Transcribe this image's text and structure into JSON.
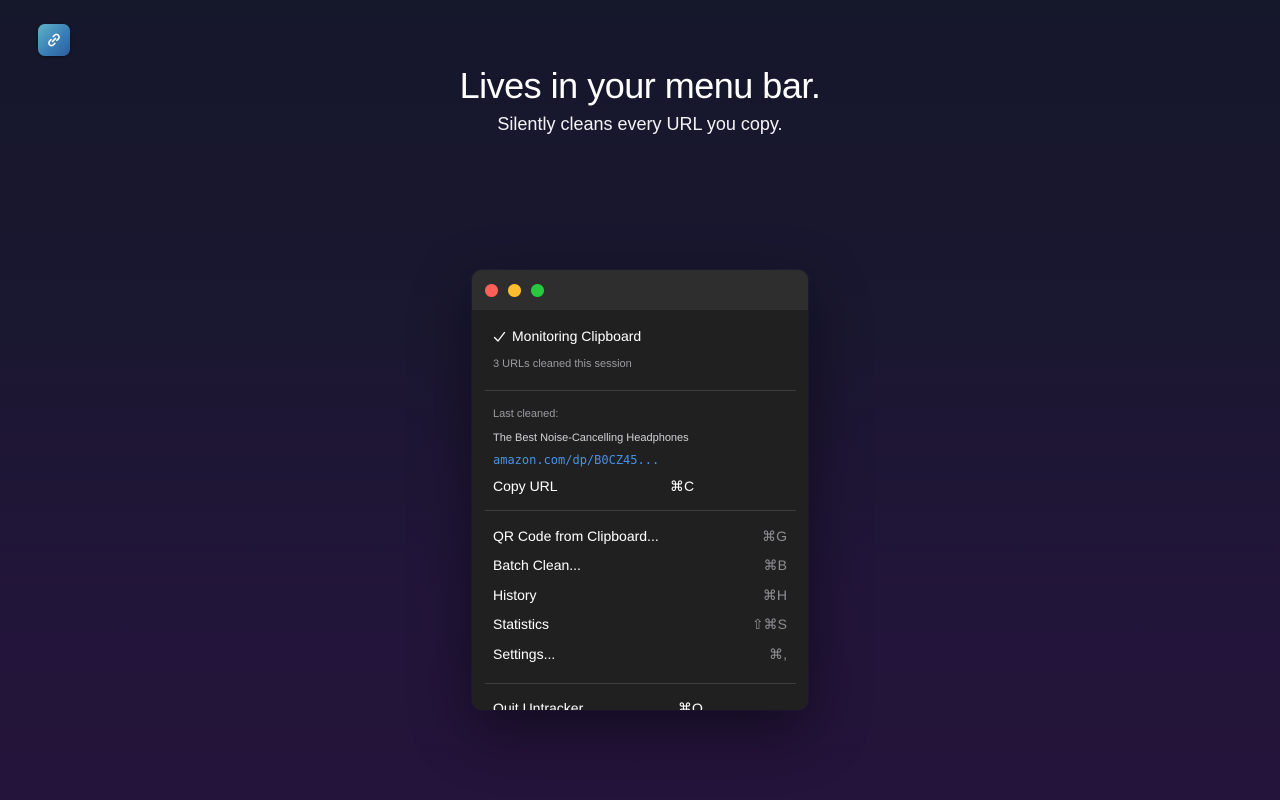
{
  "hero": {
    "title": "Lives in your menu bar.",
    "subtitle": "Silently cleans every URL you copy."
  },
  "colors": {
    "accent_link": "#4a90e2",
    "close": "#fe5f57",
    "minimize": "#febc2e",
    "maximize": "#28c840",
    "menu_bg": "#202020",
    "titlebar_bg": "#2e2e2e"
  },
  "app_icon": "link-icon",
  "menu": {
    "monitoring_label": "Monitoring Clipboard",
    "monitoring_checked": true,
    "session_count": "3 URLs cleaned this session",
    "last_cleaned_label": "Last cleaned:",
    "last_cleaned_title": "The Best Noise-Cancelling Headphones",
    "last_cleaned_url": "amazon.com/dp/B0CZ45...",
    "copy_url_label": "Copy URL",
    "copy_url_shortcut": "⌘C",
    "items": [
      {
        "label": "QR Code from Clipboard...",
        "shortcut": "⌘G"
      },
      {
        "label": "Batch Clean...",
        "shortcut": "⌘B"
      },
      {
        "label": "History",
        "shortcut": "⌘H"
      },
      {
        "label": "Statistics",
        "shortcut": "⇧⌘S"
      },
      {
        "label": "Settings...",
        "shortcut": "⌘,"
      }
    ],
    "quit_label": "Quit Untracker",
    "quit_shortcut": "⌘Q"
  }
}
